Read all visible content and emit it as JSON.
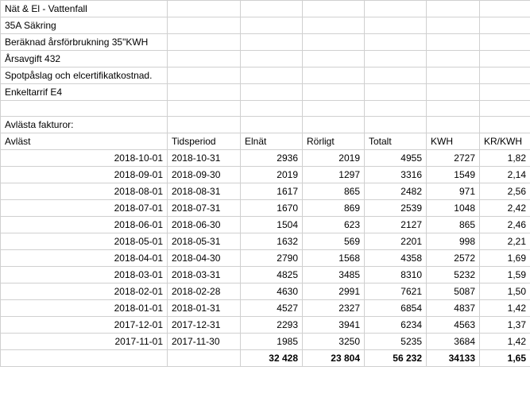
{
  "info_rows": [
    "Nät & El - Vattenfall",
    "35A Säkring",
    "Beräknad årsförbrukning 35\"KWH",
    "Årsavgift 432",
    "Spotpåslag och elcertifikatkostnad.",
    "Enkeltarrif E4"
  ],
  "section_title": "Avlästa fakturor:",
  "headers": {
    "avlast": "Avläst",
    "tidsperiod": "Tidsperiod",
    "elnat": "Elnät",
    "rorligt": "Rörligt",
    "totalt": "Totalt",
    "kwh": "KWH",
    "krkwh": "KR/KWH"
  },
  "rows": [
    {
      "avlast": "2018-10-01",
      "tidsperiod": "2018-10-31",
      "elnat": "2936",
      "rorligt": "2019",
      "totalt": "4955",
      "kwh": "2727",
      "krkwh": "1,82"
    },
    {
      "avlast": "2018-09-01",
      "tidsperiod": "2018-09-30",
      "elnat": "2019",
      "rorligt": "1297",
      "totalt": "3316",
      "kwh": "1549",
      "krkwh": "2,14"
    },
    {
      "avlast": "2018-08-01",
      "tidsperiod": "2018-08-31",
      "elnat": "1617",
      "rorligt": "865",
      "totalt": "2482",
      "kwh": "971",
      "krkwh": "2,56"
    },
    {
      "avlast": "2018-07-01",
      "tidsperiod": "2018-07-31",
      "elnat": "1670",
      "rorligt": "869",
      "totalt": "2539",
      "kwh": "1048",
      "krkwh": "2,42"
    },
    {
      "avlast": "2018-06-01",
      "tidsperiod": "2018-06-30",
      "elnat": "1504",
      "rorligt": "623",
      "totalt": "2127",
      "kwh": "865",
      "krkwh": "2,46"
    },
    {
      "avlast": "2018-05-01",
      "tidsperiod": "2018-05-31",
      "elnat": "1632",
      "rorligt": "569",
      "totalt": "2201",
      "kwh": "998",
      "krkwh": "2,21"
    },
    {
      "avlast": "2018-04-01",
      "tidsperiod": "2018-04-30",
      "elnat": "2790",
      "rorligt": "1568",
      "totalt": "4358",
      "kwh": "2572",
      "krkwh": "1,69"
    },
    {
      "avlast": "2018-03-01",
      "tidsperiod": "2018-03-31",
      "elnat": "4825",
      "rorligt": "3485",
      "totalt": "8310",
      "kwh": "5232",
      "krkwh": "1,59"
    },
    {
      "avlast": "2018-02-01",
      "tidsperiod": "2018-02-28",
      "elnat": "4630",
      "rorligt": "2991",
      "totalt": "7621",
      "kwh": "5087",
      "krkwh": "1,50"
    },
    {
      "avlast": "2018-01-01",
      "tidsperiod": "2018-01-31",
      "elnat": "4527",
      "rorligt": "2327",
      "totalt": "6854",
      "kwh": "4837",
      "krkwh": "1,42"
    },
    {
      "avlast": "2017-12-01",
      "tidsperiod": "2017-12-31",
      "elnat": "2293",
      "rorligt": "3941",
      "totalt": "6234",
      "kwh": "4563",
      "krkwh": "1,37"
    },
    {
      "avlast": "2017-11-01",
      "tidsperiod": "2017-11-30",
      "elnat": "1985",
      "rorligt": "3250",
      "totalt": "5235",
      "kwh": "3684",
      "krkwh": "1,42"
    }
  ],
  "totals": {
    "elnat": "32 428",
    "rorligt": "23 804",
    "totalt": "56 232",
    "kwh": "34133",
    "krkwh": "1,65"
  }
}
